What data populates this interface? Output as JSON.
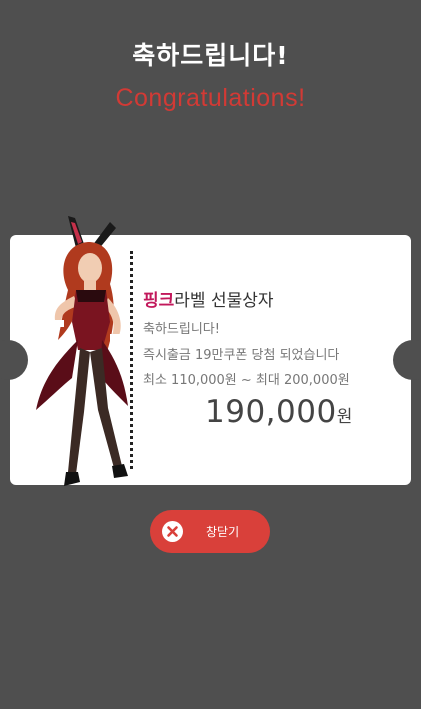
{
  "header": {
    "title_ko": "축하드립니다!",
    "title_en": "Congratulations!"
  },
  "card": {
    "prize_name_accent": "핑크",
    "prize_name_rest": "라벨 선물상자",
    "line1": "축하드립니다!",
    "line2": "즉시출금 19만쿠폰 당첨 되었습니다",
    "line3": "최소 110,000원 ~ 최대 200,000원",
    "amount": "190,000",
    "amount_unit": "원"
  },
  "close_button": {
    "label": "창닫기",
    "icon": "close-circle-icon"
  },
  "colors": {
    "background": "#4f4f4f",
    "accent_red": "#d9403a",
    "title_red": "#d23a35",
    "prize_pink": "#c2185b",
    "card": "#ffffff"
  }
}
